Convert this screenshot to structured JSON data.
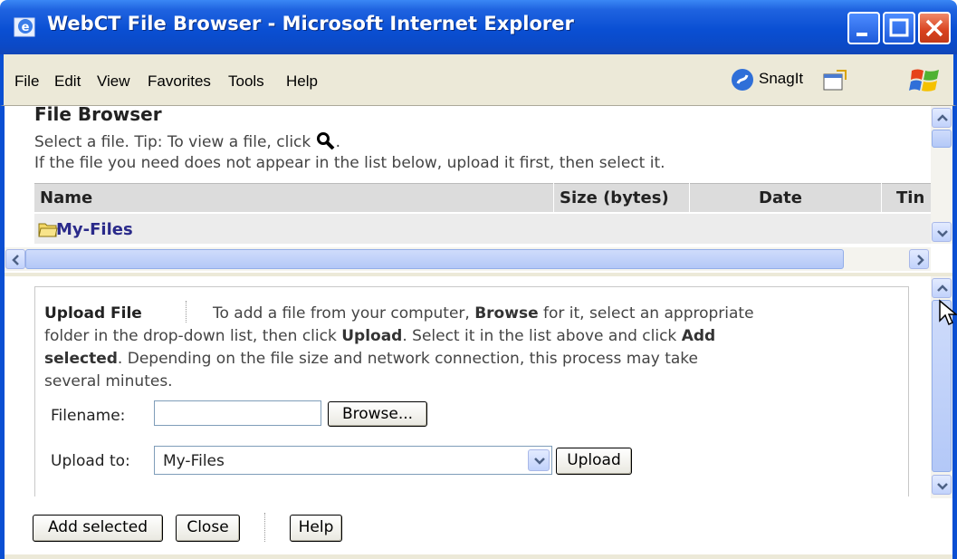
{
  "window": {
    "title": "WebCT File Browser - Microsoft Internet Explorer"
  },
  "menu": {
    "items": [
      "File",
      "Edit",
      "View",
      "Favorites",
      "Tools",
      "Help"
    ],
    "snagit_label": "SnagIt"
  },
  "file_browser": {
    "title": "File Browser",
    "tip_text": "Select a file. Tip: To view a file, click",
    "tip_suffix": ".",
    "instructions": "If the file you need does not appear in the list below, upload it first, then select it.",
    "columns": [
      "Name",
      "Size (bytes)",
      "Date",
      "Tin"
    ],
    "rows": [
      {
        "name": "My-Files",
        "size": "",
        "date": "",
        "time": ""
      }
    ]
  },
  "upload": {
    "title": "Upload File",
    "description_parts": {
      "p1": "To add a file from your computer,",
      "b1": "Browse",
      "p2": "for it, select an appropriate",
      "p3": "folder in the drop-down list, then click",
      "b2": "Upload",
      "p4": ". Select it in the list above and click",
      "b3": "Add",
      "b4": "selected",
      "p5": ". Depending on the file size and network connection, this process may take",
      "p6": "several minutes."
    },
    "filename_label": "Filename:",
    "filename_value": "",
    "browse_label": "Browse...",
    "upload_to_label": "Upload to:",
    "upload_to_value": "My-Files",
    "upload_button": "Upload"
  },
  "actions": {
    "add_selected": "Add selected",
    "close": "Close",
    "help": "Help"
  },
  "colors": {
    "titlebar": "#0a4fd3",
    "menubar": "#ece9d8",
    "link": "#2a2a8a"
  }
}
